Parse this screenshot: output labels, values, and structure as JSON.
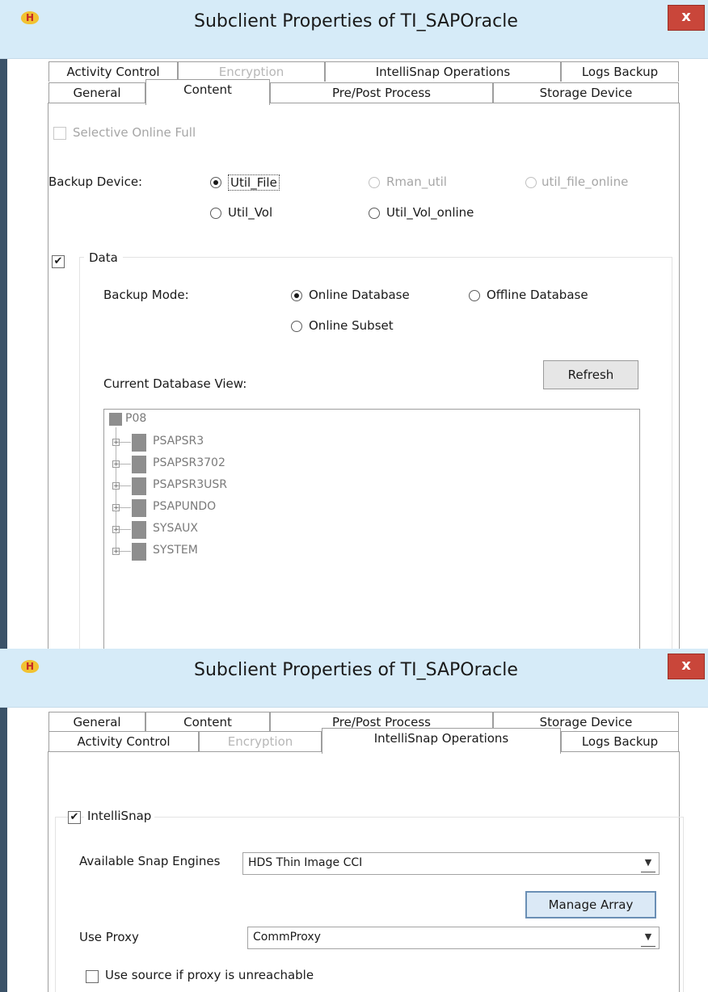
{
  "top": {
    "title": "Subclient Properties of TI_SAPOracle",
    "app_icon": "H",
    "close": "x",
    "tabs_row1": [
      "Activity Control",
      "Encryption",
      "IntelliSnap Operations",
      "Logs Backup"
    ],
    "tabs_row2": [
      "General",
      "Content",
      "Pre/Post Process",
      "Storage Device"
    ],
    "selective_online_full": "Selective Online Full",
    "backup_device_label": "Backup Device:",
    "backup_device_options": [
      "Util_File",
      "Rman_util",
      "util_file_online",
      "Util_Vol",
      "Util_Vol_online"
    ],
    "data_label": "Data",
    "backup_mode_label": "Backup Mode:",
    "backup_mode_options": [
      "Online Database",
      "Offline Database",
      "Online Subset"
    ],
    "current_db_view_label": "Current Database View:",
    "refresh_label": "Refresh",
    "tree_root": "P08",
    "tree_items": [
      "PSAPSR3",
      "PSAPSR3702",
      "PSAPSR3USR",
      "PSAPUNDO",
      "SYSAUX",
      "SYSTEM"
    ]
  },
  "bottom": {
    "title": "Subclient Properties of TI_SAPOracle",
    "app_icon": "H",
    "close": "x",
    "tabs_row1": [
      "General",
      "Content",
      "Pre/Post Process",
      "Storage Device"
    ],
    "tabs_row2": [
      "Activity Control",
      "Encryption",
      "IntelliSnap Operations",
      "Logs Backup"
    ],
    "intellisnap_label": "IntelliSnap",
    "snap_engines_label": "Available Snap Engines",
    "snap_engine_value": "HDS Thin Image CCI",
    "manage_array_label": "Manage Array",
    "use_proxy_label": "Use Proxy",
    "proxy_value": "CommProxy",
    "use_source_label": "Use source if proxy is unreachable"
  },
  "icons": {
    "check": "✔",
    "plus": "+",
    "dropdown": "▼"
  },
  "colors": {
    "titlebar": "#d6ebf8",
    "close_button": "#c9463a",
    "focus_button": "#dbe9f6"
  }
}
